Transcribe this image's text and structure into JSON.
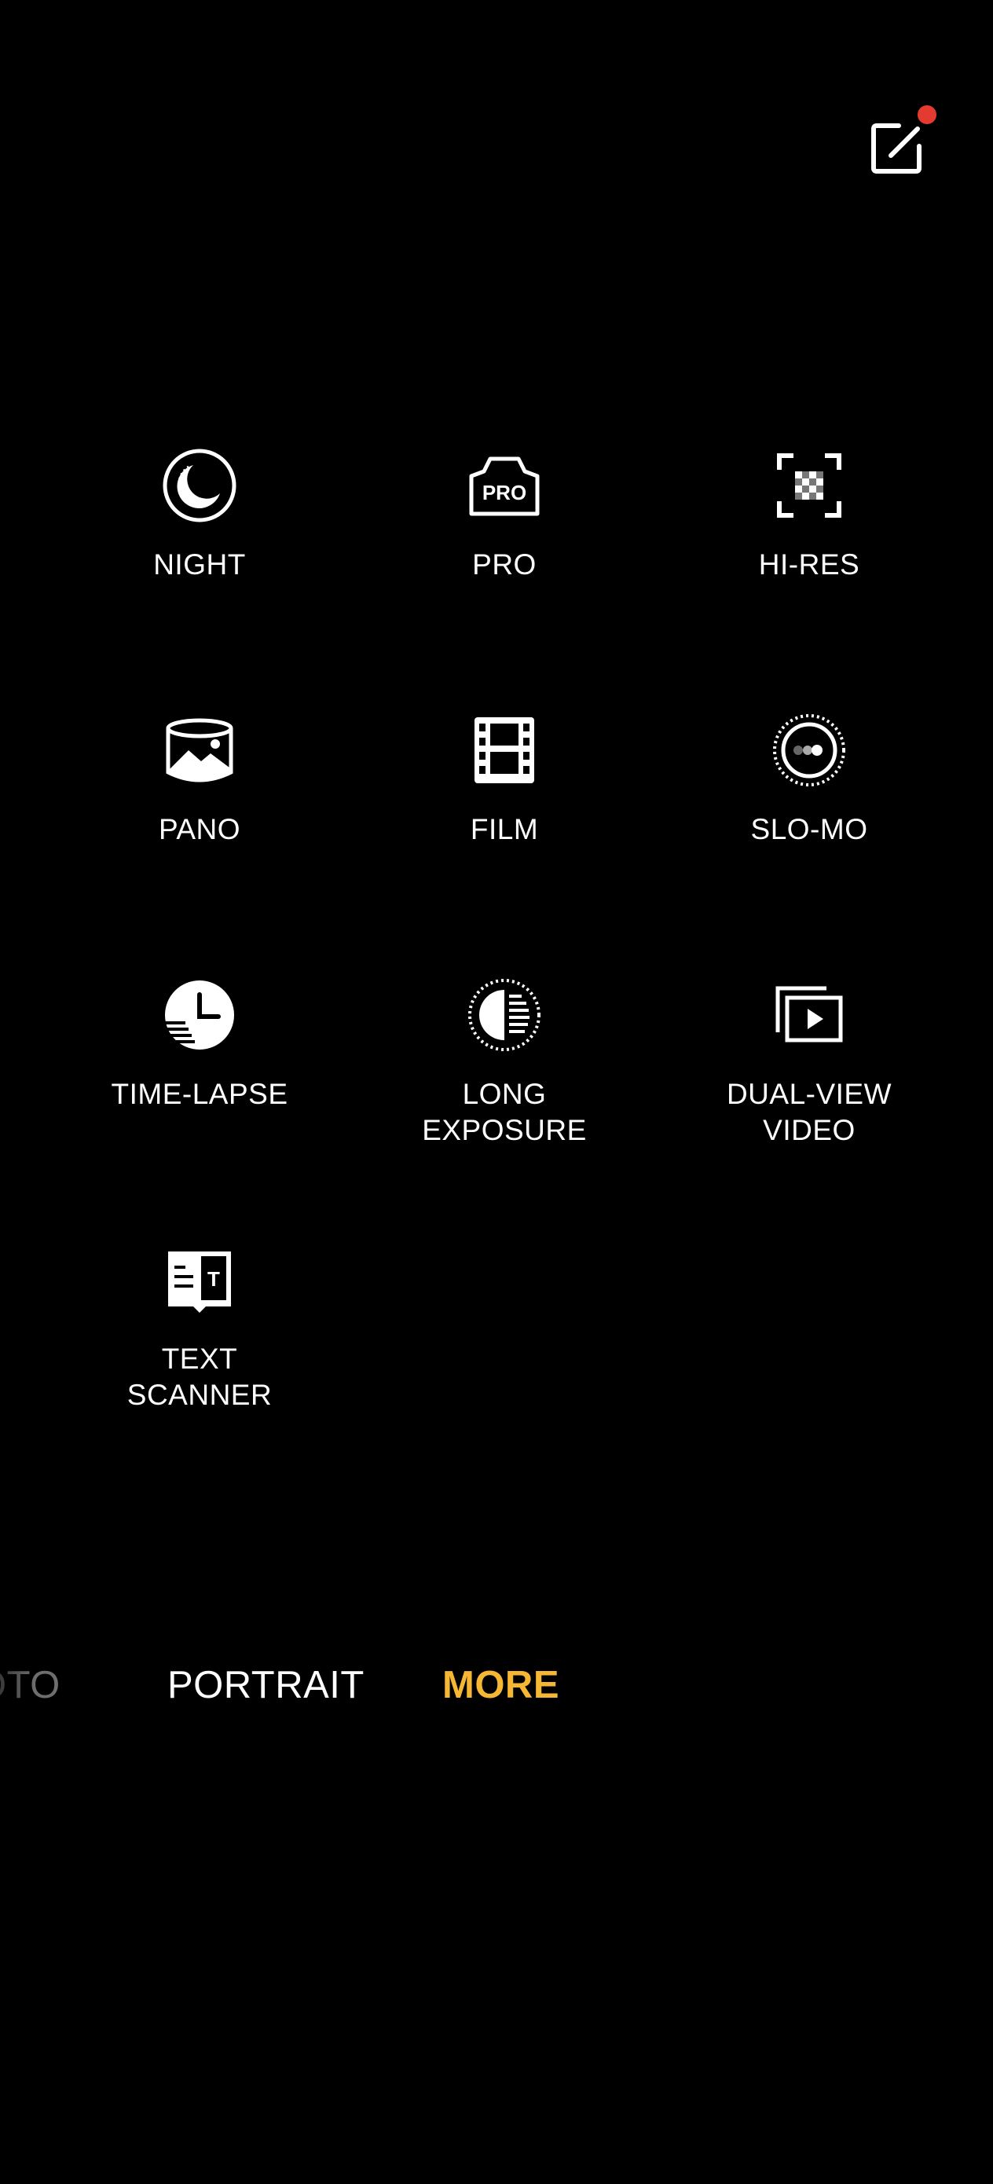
{
  "top_bar": {
    "edit_icon": "edit-modes-icon",
    "has_notification_dot": true,
    "notification_color": "#e53a2f"
  },
  "modes_grid": [
    {
      "label": "NIGHT",
      "icon": "night-icon"
    },
    {
      "label": "PRO",
      "icon": "pro-icon",
      "icon_text": "PRO"
    },
    {
      "label": "HI-RES",
      "icon": "hi-res-icon"
    },
    {
      "label": "PANO",
      "icon": "pano-icon"
    },
    {
      "label": "FILM",
      "icon": "film-icon"
    },
    {
      "label": "SLO-MO",
      "icon": "slo-mo-icon"
    },
    {
      "label": "TIME-LAPSE",
      "icon": "time-lapse-icon"
    },
    {
      "label": "LONG\nEXPOSURE",
      "icon": "long-exposure-icon"
    },
    {
      "label": "DUAL-VIEW\nVIDEO",
      "icon": "dual-view-video-icon"
    },
    {
      "label": "TEXT\nSCANNER",
      "icon": "text-scanner-icon",
      "icon_text": "T"
    }
  ],
  "mode_bar": {
    "items": [
      {
        "label": "OTO",
        "state": "faded"
      },
      {
        "label": "PORTRAIT",
        "state": "normal"
      },
      {
        "label": "MORE",
        "state": "selected"
      }
    ],
    "selected_color": "#f6b834"
  }
}
